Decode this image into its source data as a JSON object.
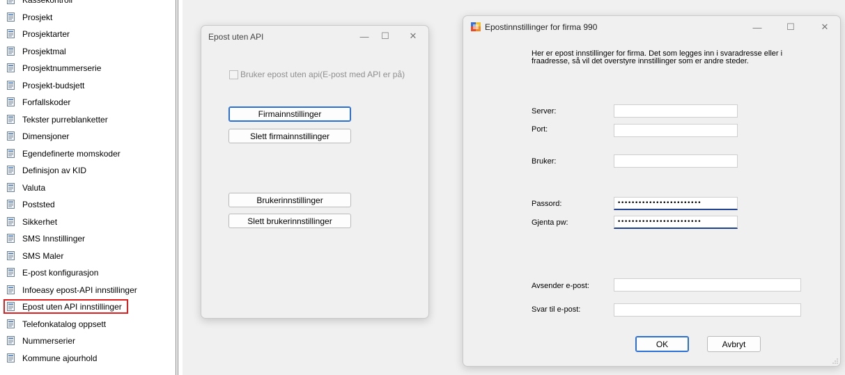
{
  "left_list": {
    "items": [
      {
        "label": "Kassekontroll",
        "selected": false
      },
      {
        "label": "Prosjekt",
        "selected": false
      },
      {
        "label": "Prosjektarter",
        "selected": false
      },
      {
        "label": "Prosjektmal",
        "selected": false
      },
      {
        "label": "Prosjektnummerserie",
        "selected": false
      },
      {
        "label": "Prosjekt-budsjett",
        "selected": false
      },
      {
        "label": "Forfallskoder",
        "selected": false
      },
      {
        "label": "Tekster purreblanketter",
        "selected": false
      },
      {
        "label": "Dimensjoner",
        "selected": false
      },
      {
        "label": "Egendefinerte momskoder",
        "selected": false
      },
      {
        "label": "Definisjon av KID",
        "selected": false
      },
      {
        "label": "Valuta",
        "selected": false
      },
      {
        "label": "Poststed",
        "selected": false
      },
      {
        "label": "Sikkerhet",
        "selected": false
      },
      {
        "label": "SMS Innstillinger",
        "selected": false
      },
      {
        "label": "SMS Maler",
        "selected": false
      },
      {
        "label": "E-post konfigurasjon",
        "selected": false
      },
      {
        "label": "Infoeasy epost-API innstillinger",
        "selected": false
      },
      {
        "label": "Epost uten API innstillinger",
        "selected": true
      },
      {
        "label": "Telefonkatalog oppsett",
        "selected": false
      },
      {
        "label": "Nummerserier",
        "selected": false
      },
      {
        "label": "Kommune ajourhold",
        "selected": false
      }
    ],
    "highlight_color": "#e02020"
  },
  "window_epost": {
    "title": "Epost uten API",
    "controls": {
      "minimize": "—",
      "maximize": "☐",
      "close": "✕"
    },
    "checkbox": {
      "label": "Bruker epost uten api(E-post med API er på)",
      "checked": false,
      "enabled": false
    },
    "buttons": {
      "firma": "Firmainnstillinger",
      "slett_firma": "Slett firmainnstillinger",
      "bruker": "Brukerinnstillinger",
      "slett_bruker": "Slett brukerinnstillinger"
    }
  },
  "window_settings": {
    "title": "Epostinnstillinger for firma 990",
    "controls": {
      "minimize": "—",
      "maximize": "☐",
      "close": "✕"
    },
    "info_text": "Her er epost innstillinger for firma. Det som legges inn i svaradresse eller i fraadresse, så vil det overstyre innstillinger som er andre steder.",
    "fields": {
      "server": {
        "label": "Server:",
        "value": ""
      },
      "port": {
        "label": "Port:",
        "value": ""
      },
      "bruker": {
        "label": "Bruker:",
        "value": ""
      },
      "passord": {
        "label": "Passord:",
        "value": "••••••••••••••••••••••••"
      },
      "gjenta_pw": {
        "label": "Gjenta pw:",
        "value": "••••••••••••••••••••••••"
      },
      "avsender": {
        "label": "Avsender e-post:",
        "value": ""
      },
      "svar_til": {
        "label": "Svar til e-post:",
        "value": ""
      }
    },
    "buttons": {
      "ok": "OK",
      "cancel": "Avbryt"
    }
  },
  "colors": {
    "focus_border": "#2a6fd6",
    "password_underline": "#1f3f8f"
  }
}
